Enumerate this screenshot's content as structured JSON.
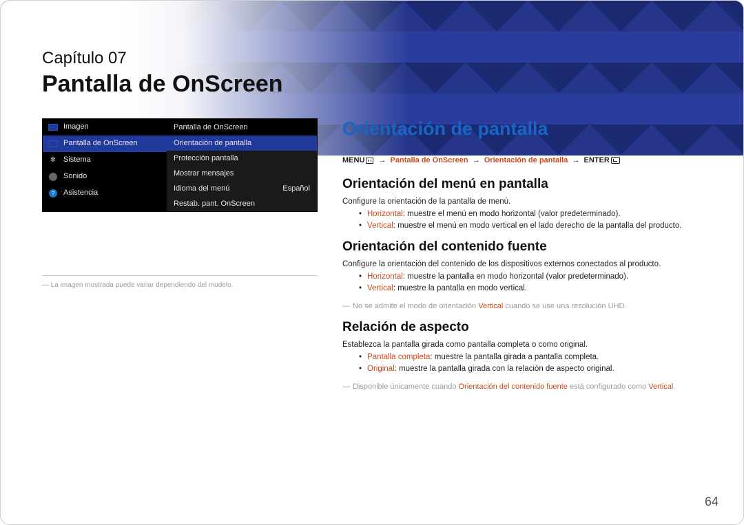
{
  "header": {
    "chapter_line": "Capítulo 07",
    "chapter_title": "Pantalla de OnScreen"
  },
  "menu": {
    "left_items": [
      {
        "icon": "rect",
        "label": "Imagen",
        "highlight": false
      },
      {
        "icon": "rect",
        "label": "Pantalla de OnScreen",
        "highlight": true
      },
      {
        "icon": "gear",
        "label": "Sistema",
        "highlight": false
      },
      {
        "icon": "speaker",
        "label": "Sonido",
        "highlight": false
      },
      {
        "icon": "help",
        "label": "Asistencia",
        "highlight": false
      }
    ],
    "right_panel_title": "Pantalla de OnScreen",
    "right_rows": [
      {
        "label": "Orientación de pantalla",
        "value": "",
        "selected": true
      },
      {
        "label": "Protección pantalla",
        "value": "",
        "selected": false
      },
      {
        "label": "Mostrar mensajes",
        "value": "",
        "selected": false
      },
      {
        "label": "Idioma del menú",
        "value": "Español",
        "selected": false
      },
      {
        "label": "Restab. pant. OnScreen",
        "value": "",
        "selected": false
      }
    ]
  },
  "left_note": "― La imagen mostrada puede variar dependiendo del modelo.",
  "section": {
    "title": "Orientación de pantalla",
    "path": {
      "menu_label": "MENU",
      "seg1": "Pantalla de OnScreen",
      "seg2": "Orientación de pantalla",
      "enter_label": "ENTER"
    },
    "sub1": {
      "heading": "Orientación del menú en pantalla",
      "intro": "Configure la orientación de la pantalla de menú.",
      "bullets": [
        {
          "kw": "Horizontal",
          "rest": ": muestre el menú en modo horizontal (valor predeterminado)."
        },
        {
          "kw": "Vertical",
          "rest": ": muestre el menú en modo vertical en el lado derecho de la pantalla del producto."
        }
      ]
    },
    "sub2": {
      "heading": "Orientación del contenido fuente",
      "intro": "Configure la orientación del contenido de los dispositivos externos conectados al producto.",
      "bullets": [
        {
          "kw": "Horizontal",
          "rest": ": muestre la pantalla en modo horizontal (valor predeterminado)."
        },
        {
          "kw": "Vertical",
          "rest": ": muestre la pantalla en modo vertical."
        }
      ],
      "note_pre": "No se admite el modo de orientación ",
      "note_kw": "Vertical",
      "note_post": " cuando se use una resolución UHD."
    },
    "sub3": {
      "heading": "Relación de aspecto",
      "intro": "Establezca la pantalla girada como pantalla completa o como original.",
      "bullets": [
        {
          "kw": "Pantalla completa",
          "rest": ": muestre la pantalla girada a pantalla completa."
        },
        {
          "kw": "Original",
          "rest": ": muestre la pantalla girada con la relación de aspecto original."
        }
      ],
      "note_pre": "Disponible únicamente cuando ",
      "note_kw1": "Orientación del contenido fuente",
      "note_mid": " está configurado como ",
      "note_kw2": "Vertical",
      "note_post": "."
    }
  },
  "page_number": "64"
}
